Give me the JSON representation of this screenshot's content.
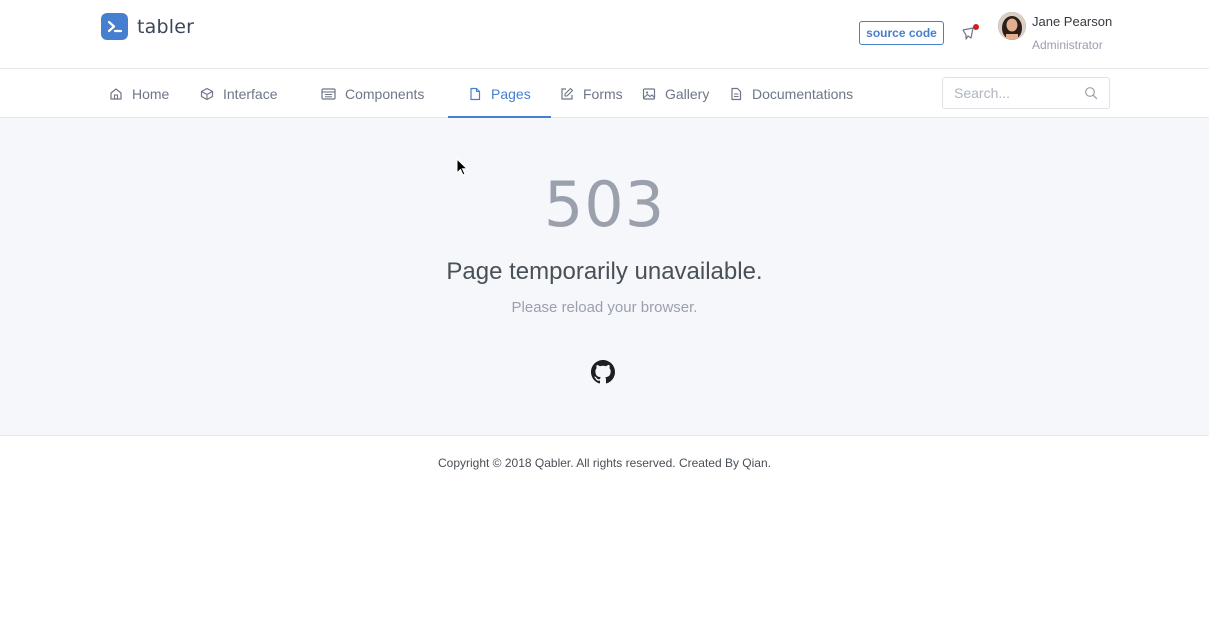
{
  "header": {
    "brand_name": "tabler",
    "source_button": "source code",
    "user": {
      "name": "Jane Pearson",
      "role": "Administrator"
    }
  },
  "nav": {
    "items": [
      {
        "label": "Home",
        "icon": "home-icon"
      },
      {
        "label": "Interface",
        "icon": "box-icon"
      },
      {
        "label": "Components",
        "icon": "calendar-icon"
      },
      {
        "label": "Pages",
        "icon": "file-icon",
        "active": true
      },
      {
        "label": "Forms",
        "icon": "edit-icon"
      },
      {
        "label": "Gallery",
        "icon": "image-icon"
      },
      {
        "label": "Documentations",
        "icon": "file-text-icon"
      }
    ],
    "search_placeholder": "Search..."
  },
  "error": {
    "code": "503",
    "title": "Page temporarily unavailable.",
    "subtitle": "Please reload your browser."
  },
  "footer": {
    "copyright": "Copyright © 2018 Qabler. All rights reserved. Created By Qian."
  },
  "colors": {
    "accent": "#467fcf",
    "background": "#f5f7fb",
    "notification_dot": "#cd201f"
  }
}
